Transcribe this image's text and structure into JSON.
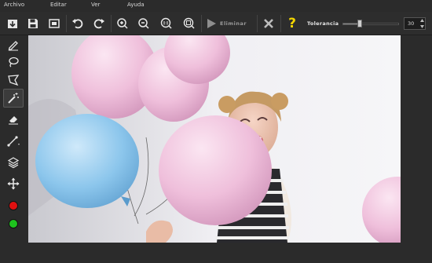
{
  "menu": {
    "archivo": "Archivo",
    "editar": "Editar",
    "ver": "Ver",
    "ayuda": "Ayuda"
  },
  "toolbar": {
    "eliminar_label": "Eliminar",
    "tolerance_label": "Tolerancia",
    "tolerance_value": "30",
    "tolerance_fraction": 0.3,
    "help_symbol": "?"
  },
  "sidebar": {
    "tools": [
      "pencil-icon",
      "lasso-icon",
      "polygon-lasso-icon",
      "magic-wand-icon",
      "eraser-icon",
      "line-icon",
      "layers-icon",
      "move-icon"
    ],
    "active_tool": "magic-wand-icon",
    "colors": {
      "primary": "#e01010",
      "secondary": "#1ec21e"
    }
  },
  "accent": {
    "help": "#f2d400"
  }
}
